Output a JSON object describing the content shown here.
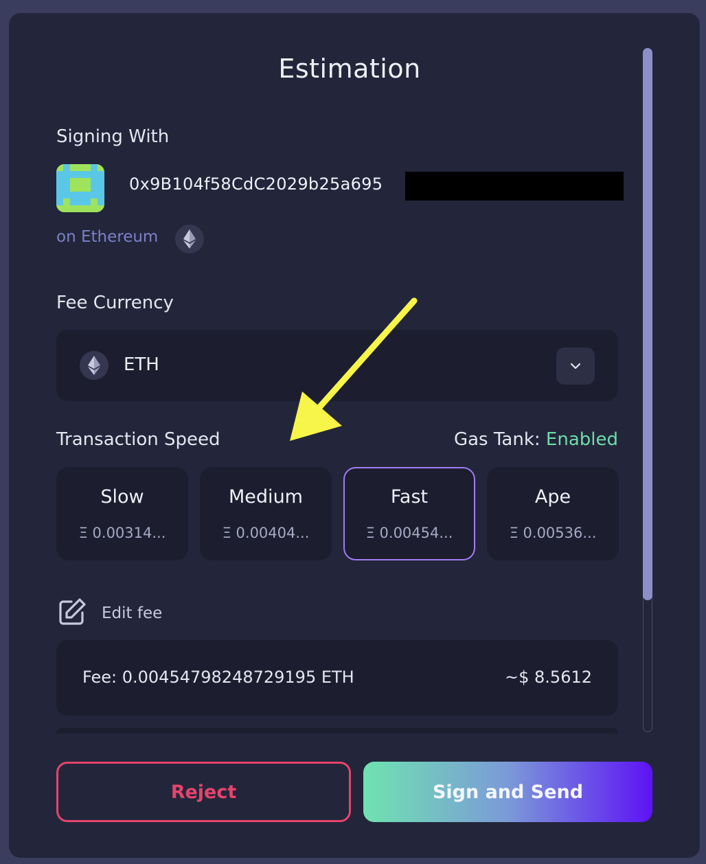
{
  "title": "Estimation",
  "signing": {
    "label": "Signing With",
    "address": "0x9B104f58CdC2029b25a695",
    "network": "on Ethereum",
    "network_icon": "eth-icon"
  },
  "fee_currency": {
    "label": "Fee Currency",
    "selected": "ETH",
    "icon": "eth-icon"
  },
  "transaction_speed": {
    "label": "Transaction Speed",
    "gas_tank_label": "Gas Tank:",
    "gas_tank_status": "Enabled",
    "options": [
      {
        "name": "Slow",
        "value": "Ξ 0.00314..."
      },
      {
        "name": "Medium",
        "value": "Ξ 0.00404..."
      },
      {
        "name": "Fast",
        "value": "Ξ 0.00454...",
        "selected": true
      },
      {
        "name": "Ape",
        "value": "Ξ 0.00536..."
      }
    ]
  },
  "edit_fee": {
    "label": "Edit fee"
  },
  "fee": {
    "text": "Fee: 0.00454798248729195 ETH",
    "usd": "~$ 8.5612"
  },
  "actions": {
    "reject": "Reject",
    "sign": "Sign and Send"
  },
  "colors": {
    "background": "#23263a",
    "accent_purple": "#a37cf5",
    "enabled_green": "#6fdcaa",
    "reject_red": "#e5446d",
    "annotation_arrow": "#f7f54a"
  }
}
